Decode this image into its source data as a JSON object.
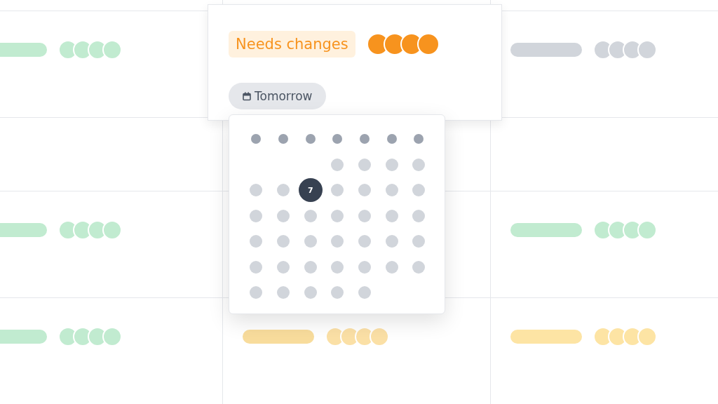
{
  "board": {
    "rows": [
      {
        "kind": "edge",
        "cells": [
          {
            "kind": "empty"
          },
          {
            "kind": "empty"
          },
          {
            "kind": "empty"
          }
        ]
      },
      {
        "kind": "tall",
        "cells": [
          {
            "kind": "status",
            "color": "#c1ebd0",
            "avatars": [
              {
                "color": "#c1ebd0"
              },
              {
                "color": "#c1ebd0"
              },
              {
                "color": "#c1ebd0"
              },
              {
                "color": "#c1ebd0"
              }
            ]
          },
          {
            "kind": "empty"
          },
          {
            "kind": "status",
            "color": "#d1d5db",
            "avatars": [
              {
                "color": "#d1d5db"
              },
              {
                "color": "#d1d5db"
              },
              {
                "color": "#d1d5db"
              },
              {
                "color": "#d1d5db"
              }
            ]
          }
        ]
      },
      {
        "kind": "short",
        "cells": [
          {
            "kind": "empty"
          },
          {
            "kind": "empty"
          },
          {
            "kind": "empty"
          }
        ]
      },
      {
        "kind": "tall",
        "cells": [
          {
            "kind": "status",
            "color": "#c1ebd0",
            "avatars": [
              {
                "color": "#c1ebd0"
              },
              {
                "color": "#c1ebd0"
              },
              {
                "color": "#c1ebd0"
              },
              {
                "color": "#c1ebd0"
              }
            ]
          },
          {
            "kind": "empty"
          },
          {
            "kind": "status",
            "color": "#c1ebd0",
            "avatars": [
              {
                "color": "#c1ebd0"
              },
              {
                "color": "#c1ebd0"
              },
              {
                "color": "#c1ebd0"
              },
              {
                "color": "#c1ebd0"
              }
            ]
          }
        ]
      },
      {
        "kind": "tall",
        "cells": [
          {
            "kind": "status",
            "color": "#c1ebd0",
            "avatars": [
              {
                "color": "#c1ebd0"
              },
              {
                "color": "#c1ebd0"
              },
              {
                "color": "#c1ebd0"
              },
              {
                "color": "#c1ebd0"
              }
            ]
          },
          {
            "kind": "status",
            "color": "#f8dc9c",
            "avatars": [
              {
                "color": "#fbe0a6"
              },
              {
                "color": "#fbe0a6"
              },
              {
                "color": "#fbe0a6"
              },
              {
                "color": "#fbe0a6"
              }
            ]
          },
          {
            "kind": "status",
            "color": "#fde4a4",
            "avatars": [
              {
                "color": "#fde4a4"
              },
              {
                "color": "#fde4a4"
              },
              {
                "color": "#fde4a4"
              },
              {
                "color": "#fde4a4"
              }
            ]
          }
        ]
      }
    ]
  },
  "card": {
    "status": {
      "label": "Needs changes",
      "color": "#f7931e"
    },
    "avatars": [
      {
        "color": "#f7931e"
      },
      {
        "color": "#f7931e"
      },
      {
        "color": "#f7931e"
      },
      {
        "color": "#f7931e"
      }
    ],
    "date_button": {
      "label": "Tomorrow"
    }
  },
  "calendar": {
    "cells": [
      {
        "kind": "weekday"
      },
      {
        "kind": "weekday"
      },
      {
        "kind": "weekday"
      },
      {
        "kind": "weekday"
      },
      {
        "kind": "weekday"
      },
      {
        "kind": "weekday"
      },
      {
        "kind": "weekday"
      },
      {
        "kind": "blank"
      },
      {
        "kind": "blank"
      },
      {
        "kind": "blank"
      },
      {
        "kind": "day",
        "selected": false
      },
      {
        "kind": "day",
        "selected": false
      },
      {
        "kind": "day",
        "selected": false
      },
      {
        "kind": "day",
        "selected": false
      },
      {
        "kind": "day",
        "selected": false
      },
      {
        "kind": "day",
        "selected": false
      },
      {
        "kind": "day",
        "selected": true,
        "label": "7"
      },
      {
        "kind": "day",
        "selected": false
      },
      {
        "kind": "day",
        "selected": false
      },
      {
        "kind": "day",
        "selected": false
      },
      {
        "kind": "day",
        "selected": false
      },
      {
        "kind": "day",
        "selected": false
      },
      {
        "kind": "day",
        "selected": false
      },
      {
        "kind": "day",
        "selected": false
      },
      {
        "kind": "day",
        "selected": false
      },
      {
        "kind": "day",
        "selected": false
      },
      {
        "kind": "day",
        "selected": false
      },
      {
        "kind": "day",
        "selected": false
      },
      {
        "kind": "day",
        "selected": false
      },
      {
        "kind": "day",
        "selected": false
      },
      {
        "kind": "day",
        "selected": false
      },
      {
        "kind": "day",
        "selected": false
      },
      {
        "kind": "day",
        "selected": false
      },
      {
        "kind": "day",
        "selected": false
      },
      {
        "kind": "day",
        "selected": false
      },
      {
        "kind": "day",
        "selected": false
      },
      {
        "kind": "day",
        "selected": false
      },
      {
        "kind": "day",
        "selected": false
      },
      {
        "kind": "day",
        "selected": false
      },
      {
        "kind": "day",
        "selected": false
      },
      {
        "kind": "day",
        "selected": false
      },
      {
        "kind": "day",
        "selected": false
      },
      {
        "kind": "day",
        "selected": false
      },
      {
        "kind": "day",
        "selected": false
      },
      {
        "kind": "day",
        "selected": false
      },
      {
        "kind": "day",
        "selected": false
      },
      {
        "kind": "day",
        "selected": false
      }
    ]
  }
}
